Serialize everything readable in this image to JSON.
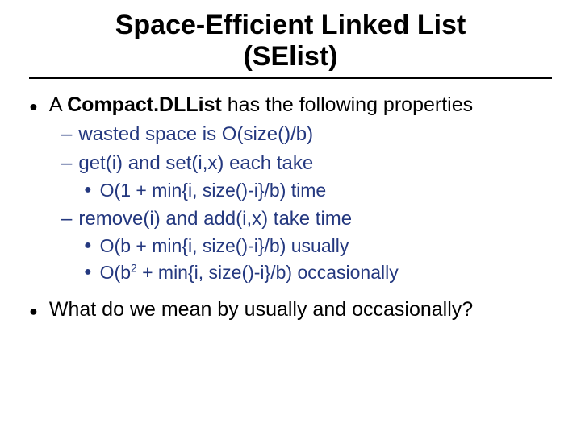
{
  "title_line1": "Space-Efficient Linked List",
  "title_line2": "(SElist)",
  "b1_a_pre": "A ",
  "b1_a_bold": "Compact.DLList",
  "b1_a_post": " has the following properties",
  "b2_a": "wasted space is O(size()/b)",
  "b2_b": "get(i) and set(i,x) each take",
  "b3_a": "O(1 + min{i, size()-i}/b) time",
  "b2_c": "remove(i) and add(i,x) take time",
  "b3_b": "O(b + min{i, size()-i}/b) usually",
  "b3_c_pre": "O(b",
  "b3_c_sup": "2",
  "b3_c_post": " + min{i, size()-i}/b) occasionally",
  "b1_b_pre": "What do we mean by usually and occasionall",
  "b1_b_tail": "y?"
}
